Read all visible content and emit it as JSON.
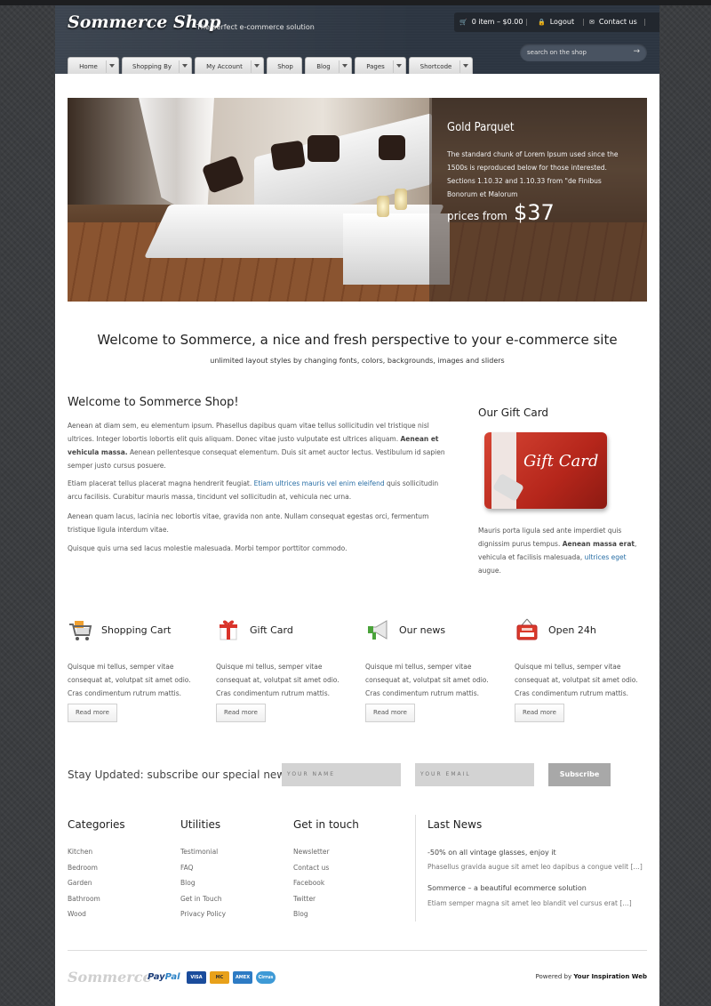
{
  "header": {
    "logo": "Sommerce Shop",
    "tagline": "The perfect e-commerce solution",
    "cart": "0 item – $0.00",
    "logout": "Logout",
    "contact": "Contact us",
    "search_placeholder": "search on the shop"
  },
  "nav": [
    "Home",
    "Shopping By",
    "My Account",
    "Shop",
    "Blog",
    "Pages",
    "Shortcode"
  ],
  "slider": {
    "title": "Gold Parquet",
    "description": "The standard chunk of Lorem Ipsum used since the 1500s is reproduced below for those interested. Sections 1.10.32 and 1.10.33 from \"de Finibus Bonorum et Malorum",
    "price_label": "prices from",
    "price_value": "$37"
  },
  "welcome": {
    "title": "Welcome to Sommerce, a nice and fresh perspective to your e-commerce site",
    "subtitle": "unlimited layout styles by changing fonts, colors, backgrounds, images and sliders"
  },
  "main": {
    "heading": "Welcome to Sommerce Shop!",
    "p1_a": "Aenean at diam sem, eu elementum ipsum. Phasellus dapibus quam vitae tellus sollicitudin vel tristique nisl ultrices. Integer lobortis lobortis elit quis aliquam. Donec vitae justo vulputate est ultrices aliquam. ",
    "p1_bold": "Aenean et vehicula massa.",
    "p1_b": " Aenean pellentesque consequat elementum. Duis sit amet auctor lectus. Vestibulum id sapien semper justo cursus posuere.",
    "p2_a": "Etiam placerat tellus placerat magna hendrerit feugiat. ",
    "p2_link": "Etiam ultrices mauris vel enim eleifend",
    "p2_b": " quis sollicitudin arcu facilisis. Curabitur mauris massa, tincidunt vel sollicitudin at, vehicula nec urna.",
    "p3": "Aenean quam lacus, lacinia nec lobortis vitae, gravida non ante. Nullam consequat egestas orci, fermentum tristique ligula interdum vitae.",
    "p4": "Quisque quis urna sed lacus molestie malesuada. Morbi tempor porttitor commodo."
  },
  "gift": {
    "heading": "Our Gift Card",
    "card_text": "Gift Card",
    "p_a": "Mauris porta ligula sed ante imperdiet quis dignissim purus tempus. ",
    "p_bold": "Aenean massa erat",
    "p_b": ", vehicula et facilisis malesuada, ",
    "p_link": "ultrices eget",
    "p_c": " augue."
  },
  "features": [
    {
      "title": "Shopping Cart",
      "icon": "shopping-cart-icon",
      "text": "Quisque mi tellus, semper vitae consequat at, volutpat sit amet odio. Cras condimentum rutrum mattis.",
      "button": "Read more"
    },
    {
      "title": "Gift Card",
      "icon": "gift-icon",
      "text": "Quisque mi tellus, semper vitae consequat at, volutpat sit amet odio. Cras condimentum rutrum mattis.",
      "button": "Read more"
    },
    {
      "title": "Our news",
      "icon": "megaphone-icon",
      "text": "Quisque mi tellus, semper vitae consequat at, volutpat sit amet odio. Cras condimentum rutrum mattis.",
      "button": "Read more"
    },
    {
      "title": "Open 24h",
      "icon": "open-sign-icon",
      "text": "Quisque mi tellus, semper vitae consequat at, volutpat sit amet odio. Cras condimentum rutrum mattis.",
      "button": "Read more"
    }
  ],
  "newsletter": {
    "heading": "Stay Updated: subscribe our special newsletter",
    "name_placeholder": "YOUR NAME",
    "email_placeholder": "YOUR EMAIL",
    "button": "Subscribe"
  },
  "footer_cols": [
    {
      "title": "Categories",
      "items": [
        "Kitchen",
        "Bedroom",
        "Garden",
        "Bathroom",
        "Wood"
      ]
    },
    {
      "title": "Utilities",
      "items": [
        "Testimonial",
        "FAQ",
        "Blog",
        "Get in Touch",
        "Privacy Policy"
      ]
    },
    {
      "title": "Get in touch",
      "items": [
        "Newsletter",
        "Contact us",
        "Facebook",
        "Twitter",
        "Blog"
      ]
    }
  ],
  "last_news": {
    "title": "Last News",
    "items": [
      {
        "title": "-50% on all vintage glasses, enjoy it",
        "text": "Phasellus gravida augue sit amet leo dapibus a congue velit […]"
      },
      {
        "title": "Sommerce – a beautiful ecommerce solution",
        "text": "Etiam semper magna sit amet leo blandit vel cursus erat […]"
      }
    ]
  },
  "bottom": {
    "logo": "Sommerce",
    "paypal_a": "Pay",
    "paypal_b": "Pal",
    "cards": [
      "VISA",
      "MC",
      "AMEX",
      "Cirrus"
    ],
    "powered_prefix": "Powered by ",
    "powered_name": "Your Inspiration Web"
  },
  "colors": {
    "accent_link": "#2a6fa6",
    "header_bg": "#2c3541"
  }
}
